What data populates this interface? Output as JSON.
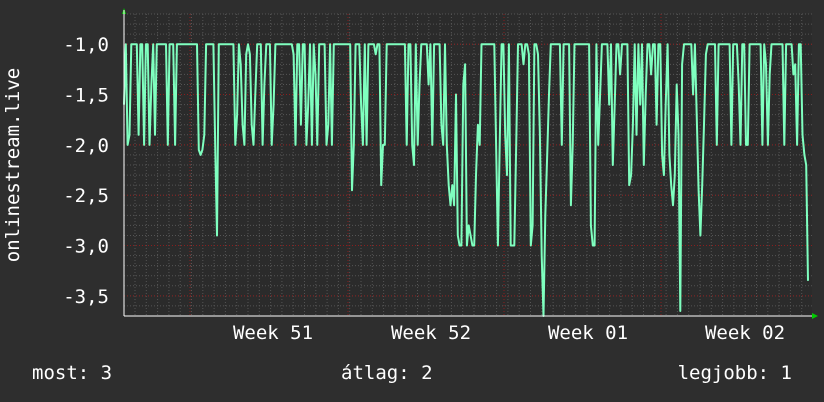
{
  "chart_data": {
    "type": "line",
    "ylabel": "onlinestream.live",
    "ylim": [
      -3.7,
      -0.7
    ],
    "yticks": [
      -1.0,
      -1.5,
      -2.0,
      -2.5,
      -3.0,
      -3.5
    ],
    "ytick_labels": [
      "-1,0",
      "-1,5",
      "-2,0",
      "-2,5",
      "-3,0",
      "-3,5"
    ],
    "xtick_labels": [
      "Week 51",
      "Week 52",
      "Week 01",
      "Week 02"
    ],
    "grid": true,
    "series": [
      {
        "color": "#7fffbf",
        "values": [
          -1.6,
          -1,
          -2,
          -1.9,
          -1,
          -1,
          -1,
          -1,
          -1.9,
          -1,
          -1,
          -2,
          -1,
          -1,
          -2,
          -1.4,
          -1,
          -1.9,
          -1,
          -1,
          -1,
          -1,
          -1,
          -1,
          -2,
          -1,
          -1,
          -1,
          -2,
          -1,
          -1,
          -1,
          -1,
          -1,
          -1,
          -1,
          -1,
          -1,
          -1,
          -1,
          -1,
          -2.05,
          -2.1,
          -2.05,
          -1.9,
          -1,
          -1,
          -1,
          -1,
          -1,
          -2,
          -2.9,
          -1,
          -1,
          -1,
          -1,
          -1,
          -1,
          -1,
          -1,
          -1,
          -2,
          -1.7,
          -1,
          -1.2,
          -1.8,
          -2,
          -1.1,
          -1,
          -1.1,
          -1.8,
          -2,
          -1.5,
          -1,
          -1,
          -1,
          -2,
          -1.4,
          -1,
          -1,
          -1,
          -2,
          -1.6,
          -1,
          -1,
          -1,
          -1,
          -1,
          -1,
          -1,
          -1,
          -1,
          -1,
          -1.1,
          -2,
          -1,
          -1,
          -1.8,
          -1,
          -1,
          -2,
          -1.6,
          -1,
          -2,
          -1,
          -1.3,
          -2,
          -1,
          -1,
          -1,
          -1,
          -2,
          -1.8,
          -1,
          -2,
          -1,
          -1,
          -1,
          -1,
          -1,
          -1,
          -1,
          -1,
          -1,
          -1,
          -2.45,
          -2,
          -1,
          -1,
          -1,
          -1.6,
          -2,
          -1,
          -2,
          -1,
          -1,
          -1,
          -1,
          -1.1,
          -1,
          -1,
          -2.4,
          -2,
          -2,
          -1,
          -1,
          -1,
          -1,
          -1,
          -1,
          -1,
          -1,
          -1,
          -1,
          -1,
          -2,
          -1,
          -1,
          -2,
          -2.2,
          -1,
          -2,
          -1.4,
          -1,
          -1,
          -1,
          -1,
          -1.4,
          -1,
          -2,
          -1,
          -1,
          -1,
          -1,
          -1.8,
          -2,
          -1,
          -2,
          -2.4,
          -2.6,
          -2.4,
          -2.6,
          -1.5,
          -2.9,
          -3,
          -3,
          -1.4,
          -1.2,
          -3,
          -2.8,
          -2.9,
          -3,
          -3,
          -2.3,
          -1.8,
          -2,
          -1,
          -1,
          -1,
          -1,
          -1,
          -1,
          -1,
          -1,
          -2,
          -3,
          -2,
          -1,
          -1,
          -1.9,
          -2.3,
          -1,
          -3,
          -3,
          -3,
          -2,
          -1,
          -1,
          -1,
          -1.2,
          -1,
          -1,
          -1.1,
          -3,
          -2.8,
          -1,
          -1,
          -1.1,
          -1.9,
          -3.1,
          -3.7,
          -2.7,
          -2.1,
          -1.5,
          -1,
          -1,
          -1,
          -1,
          -1,
          -1,
          -2,
          -1,
          -1,
          -1,
          -1,
          -2.6,
          -2,
          -1,
          -1,
          -1,
          -1,
          -1,
          -1,
          -1,
          -1,
          -1,
          -2.8,
          -3,
          -3,
          -1,
          -2,
          -1.5,
          -1,
          -1,
          -1,
          -1,
          -1.6,
          -1,
          -2.2,
          -1.6,
          -1,
          -1,
          -1.3,
          -1,
          -1,
          -1,
          -1,
          -2.4,
          -2.3,
          -1.8,
          -1,
          -1.9,
          -1,
          -1.6,
          -1,
          -2.2,
          -1.5,
          -1,
          -1,
          -1.3,
          -1,
          -1,
          -1.8,
          -1,
          -1,
          -2.1,
          -2.3,
          -1.6,
          -1,
          -2.1,
          -2.4,
          -2.6,
          -2.3,
          -1.4,
          -1.9,
          -3.65,
          -1.2,
          -1,
          -1,
          -1,
          -1,
          -1,
          -1.5,
          -1,
          -1.7,
          -2.45,
          -2.9,
          -2.4,
          -1.8,
          -1.1,
          -1,
          -1,
          -1,
          -1,
          -1,
          -2,
          -1,
          -1,
          -1,
          -1,
          -1,
          -1,
          -1,
          -2,
          -1,
          -1,
          -1,
          -1.4,
          -2,
          -1,
          -1,
          -2,
          -2,
          -1,
          -1,
          -1,
          -1,
          -1,
          -1,
          -1,
          -2,
          -1,
          -1.2,
          -2,
          -1.3,
          -1,
          -1,
          -1,
          -1,
          -1,
          -1,
          -1,
          -2,
          -1,
          -1,
          -1,
          -1,
          -1.3,
          -1.2,
          -2,
          -1,
          -1,
          -1.9,
          -2.1,
          -2.2,
          -3.35
        ]
      }
    ]
  },
  "footer": {
    "now": "most: 3",
    "avg": "átlag: 2",
    "best": "legjobb: 1"
  },
  "colors": {
    "background": "#2e2e2e",
    "plot_background": "#2b2b2b",
    "grid": "#8b1e1e",
    "line": "#7fffbf",
    "axis": "#ffffff",
    "arrow": "#00cc00"
  }
}
